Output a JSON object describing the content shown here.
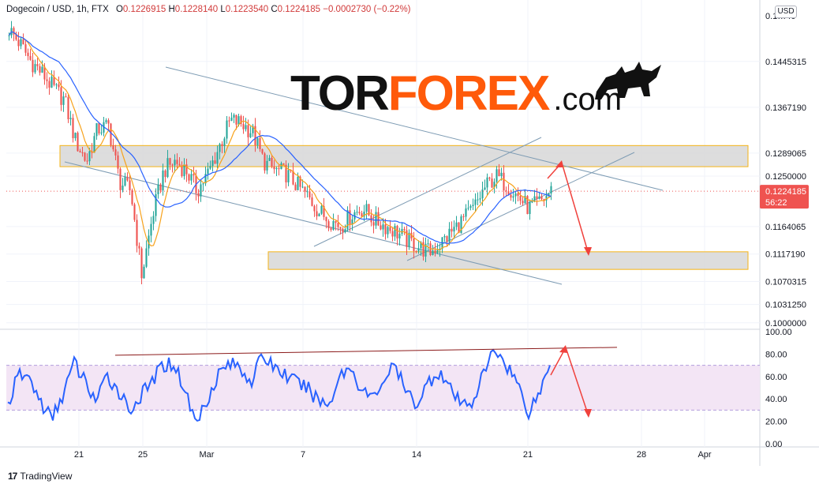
{
  "header": {
    "symbol": "Dogecoin / USD, 1h, FTX",
    "o_label": "O",
    "o_value": "0.1226915",
    "h_label": "H",
    "h_value": "0.1228140",
    "l_label": "L",
    "l_value": "0.1223540",
    "c_label": "C",
    "c_value": "0.1224185",
    "change": "−0.0002730 (−0.22%)"
  },
  "currency": "USD",
  "watermark": {
    "part1": "TOR",
    "part2": "FOREX",
    "part3": ".com"
  },
  "footer": {
    "logo": "17",
    "brand": "TradingView"
  },
  "colors": {
    "up": "#26a69a",
    "down": "#ef5350",
    "ma_fast": "#f7a21b",
    "ma_slow": "#2962ff",
    "rsi": "#2962ff",
    "rsi_band": "#f3e5f5",
    "zone": "#d9d9d9",
    "zone_border": "#f5b316",
    "channel": "#7e9cb4",
    "arrow": "#f0413c",
    "badge": "#ef5350"
  },
  "chart_data": [
    {
      "type": "candlestick",
      "title": "",
      "y_ticks": [
        "0.1445315",
        "0.1367190",
        "0.1289065",
        "0.1250000",
        "0.1164065",
        "0.1117190",
        "0.1070315",
        "0.1031250",
        "0.1000000"
      ],
      "top_tick_partial": "0.1…40",
      "ylim": [
        0.0993,
        0.1515
      ],
      "x_ticks": [
        "21",
        "25",
        "Mar",
        "7",
        "14",
        "21",
        "28",
        "Apr"
      ],
      "last_price": "0.1224185",
      "countdown": "56:22",
      "price_path": [
        0.15,
        0.1475,
        0.1445,
        0.1425,
        0.14,
        0.138,
        0.131,
        0.1275,
        0.133,
        0.1335,
        0.124,
        0.1225,
        0.108,
        0.1185,
        0.126,
        0.1275,
        0.126,
        0.1225,
        0.1255,
        0.13,
        0.1345,
        0.134,
        0.1325,
        0.1275,
        0.126,
        0.1255,
        0.1235,
        0.1215,
        0.119,
        0.1175,
        0.1165,
        0.1185,
        0.1195,
        0.1175,
        0.1165,
        0.1155,
        0.114,
        0.113,
        0.112,
        0.1135,
        0.1155,
        0.1175,
        0.1195,
        0.123,
        0.125,
        0.1235,
        0.1215,
        0.1195,
        0.1205,
        0.1225
      ],
      "support_zone": [
        0.1091,
        0.1121
      ],
      "resistance_zone": [
        0.1266,
        0.1302
      ]
    },
    {
      "type": "line",
      "title": "",
      "y_ticks": [
        "100.00",
        "80.00",
        "60.00",
        "40.00",
        "20.00",
        "0.00"
      ],
      "ylim": [
        0,
        100
      ],
      "band": [
        30,
        70
      ],
      "series": [
        {
          "values": [
            35,
            62,
            58,
            36,
            22,
            45,
            72,
            55,
            38,
            60,
            48,
            30,
            42,
            55,
            70,
            72,
            48,
            18,
            40,
            62,
            72,
            68,
            56,
            78,
            70,
            62,
            55,
            50,
            40,
            34,
            62,
            68,
            48,
            40,
            58,
            70,
            45,
            36,
            55,
            65,
            48,
            34,
            38,
            62,
            85,
            72,
            56,
            28,
            45,
            70
          ]
        }
      ]
    }
  ]
}
